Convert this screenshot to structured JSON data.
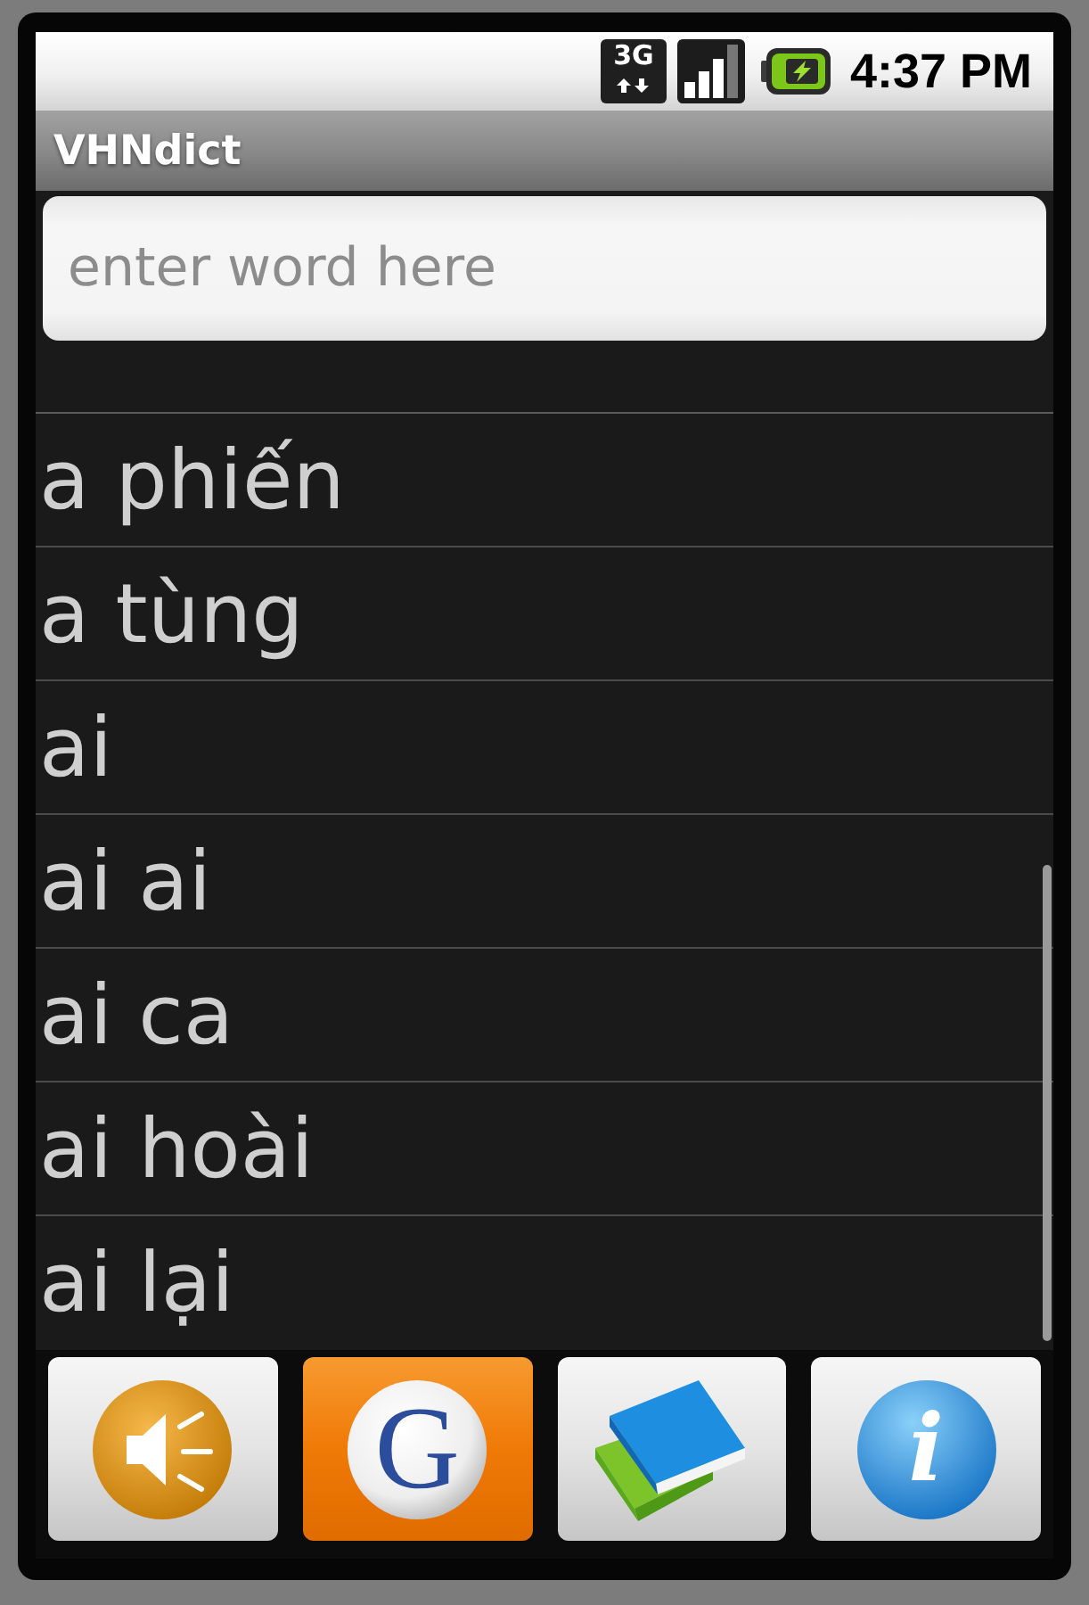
{
  "status_bar": {
    "network": "3G",
    "time": "4:37 PM"
  },
  "window": {
    "title": "VHNdict"
  },
  "search": {
    "placeholder": "enter word here"
  },
  "word_list": {
    "items": [
      "a phiến",
      "a tùng",
      "ai",
      "ai ai",
      "ai ca",
      "ai hoài",
      "ai lại"
    ]
  },
  "toolbar": [
    {
      "kind": "speak",
      "selected": false
    },
    {
      "kind": "web",
      "label": "G",
      "selected": true
    },
    {
      "kind": "dictionary",
      "selected": false
    },
    {
      "kind": "about",
      "label": "i",
      "selected": false
    }
  ]
}
